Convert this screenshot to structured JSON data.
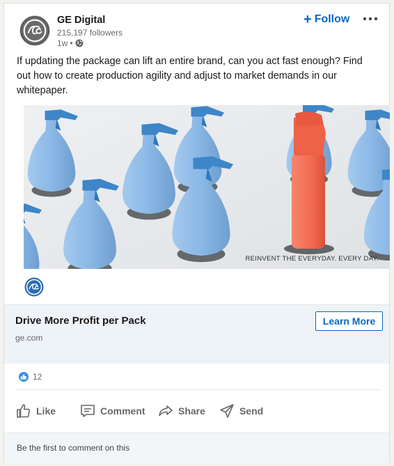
{
  "post": {
    "company": {
      "name": "GE Digital",
      "followers": "215,197 followers",
      "age": "1w",
      "separator": "•",
      "logo_icon": "ge-monogram-logo",
      "visibility_icon": "globe-icon"
    },
    "follow_label": "Follow",
    "follow_icon": "plus-icon",
    "more_icon": "more-dots-icon",
    "text": "If updating the package can lift an entire brand, can you act fast enough? Find out how to create production agility and adjust to market demands in our whitepaper.",
    "image": {
      "caption": "REINVENT THE EVERYDAY. EVERY DAY."
    },
    "link_card": {
      "title": "Drive More Profit per Pack",
      "domain": "ge.com",
      "cta_label": "Learn More"
    },
    "reactions": {
      "count": "12",
      "icon": "like-reaction-icon"
    },
    "actions": [
      {
        "label": "Like",
        "icon": "thumbs-up-icon"
      },
      {
        "label": "Comment",
        "icon": "comment-icon"
      },
      {
        "label": "Share",
        "icon": "share-icon"
      },
      {
        "label": "Send",
        "icon": "send-icon"
      }
    ],
    "comments_prompt": "Be the first to comment on this"
  },
  "colors": {
    "accent": "#0a66c2",
    "bottle_blue": "#8ab8e6",
    "bottle_orange": "#f26a4f",
    "link_bg": "#eef3f8"
  }
}
